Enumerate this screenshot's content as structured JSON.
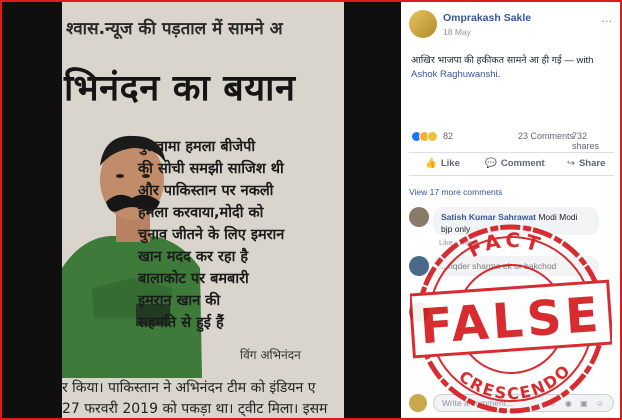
{
  "newspaper": {
    "top_line": "श्वास.न्यूज की पड़ताल में सामने अ",
    "headline": "भिनंदन का बयान",
    "quote_lines": [
      "पुलवामा हमला बीजेपी",
      "की सोची समझी साजिश थी",
      "और पाकिस्तान पर नकली",
      "हमला करवाया,मोदी को",
      "चुनाव जीतने के लिए इमरान",
      "खान मदद कर रहा है",
      "बालाकोट पर बमबारी",
      "इमरान खान की",
      "सहमति से हुई हैं"
    ],
    "byline": "विंग अभिनंदन",
    "footer_line1": "र किया। पाकिस्तान ने अभिनंदन   टीम को इंडियन ए",
    "footer_line2": "27 फरवरी 2019 को पकड़ा था।   ट्वीट मिला। इसम"
  },
  "post": {
    "author": "Omprakash Sakle",
    "date": "18 May",
    "more_icon": "...",
    "text": "आखिर भाजपा की हकीकत सामने आ ही गई",
    "with_prefix": " — with ",
    "tagged_user": "Ashok Raghuwanshi",
    "reaction_count": "82",
    "comments_count": "23 Comments",
    "shares_count": "732 shares",
    "actions": {
      "like": "Like",
      "comment": "Comment",
      "share": "Share"
    },
    "view_more": "View 17 more comments",
    "comments": [
      {
        "name": "Satish Kumar Sahrawat",
        "text": "Modi Modi bjp only",
        "meta": "Like · Reply"
      },
      {
        "name": "",
        "text": "...riqder sharma ek or bakchod"
      },
      {
        "name": "",
        "text": ""
      }
    ],
    "write_placeholder": "Write a comment...",
    "write_icons": "☺ ◉ ▣ ☺"
  },
  "stamp": {
    "top_word": "FACT",
    "main_word": "FALSE",
    "bottom_word": "CRESCENDO",
    "color": "#d4161a"
  },
  "icons": {
    "like": "like-icon",
    "comment": "comment-icon",
    "share": "share-icon"
  }
}
